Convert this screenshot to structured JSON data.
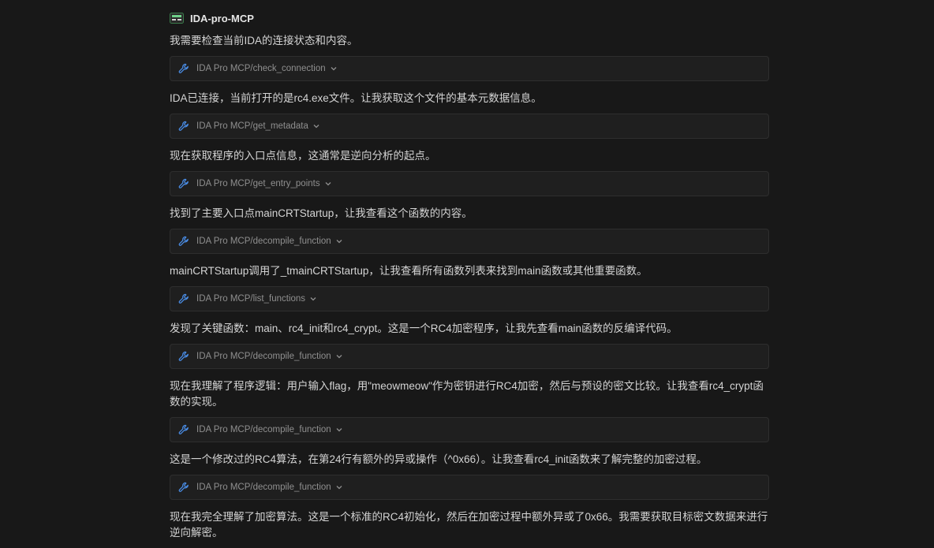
{
  "agent": {
    "name": "IDA-pro-MCP",
    "icon": "terminal-badge-icon"
  },
  "colors": {
    "background": "#181818",
    "card": "#1f1f1f",
    "accent_icon": "#4a8ee8"
  },
  "steps": [
    {
      "message": "我需要检查当前IDA的连接状态和内容。",
      "tool": "IDA Pro MCP/check_connection"
    },
    {
      "message": "IDA已连接，当前打开的是rc4.exe文件。让我获取这个文件的基本元数据信息。",
      "tool": "IDA Pro MCP/get_metadata"
    },
    {
      "message": "现在获取程序的入口点信息，这通常是逆向分析的起点。",
      "tool": "IDA Pro MCP/get_entry_points"
    },
    {
      "message": "找到了主要入口点mainCRTStartup，让我查看这个函数的内容。",
      "tool": "IDA Pro MCP/decompile_function"
    },
    {
      "message": "mainCRTStartup调用了_tmainCRTStartup，让我查看所有函数列表来找到main函数或其他重要函数。",
      "tool": "IDA Pro MCP/list_functions"
    },
    {
      "message": "发现了关键函数：main、rc4_init和rc4_crypt。这是一个RC4加密程序，让我先查看main函数的反编译代码。",
      "tool": "IDA Pro MCP/decompile_function"
    },
    {
      "message": "现在我理解了程序逻辑：用户输入flag，用\"meowmeow\"作为密钥进行RC4加密，然后与预设的密文比较。让我查看rc4_crypt函数的实现。",
      "tool": "IDA Pro MCP/decompile_function"
    },
    {
      "message": "这是一个修改过的RC4算法，在第24行有额外的异或操作（^0x66）。让我查看rc4_init函数来了解完整的加密过程。",
      "tool": "IDA Pro MCP/decompile_function"
    }
  ],
  "final_message": "现在我完全理解了加密算法。这是一个标准的RC4初始化，然后在加密过程中额外异或了0x66。我需要获取目标密文数据来进行逆向解密。"
}
